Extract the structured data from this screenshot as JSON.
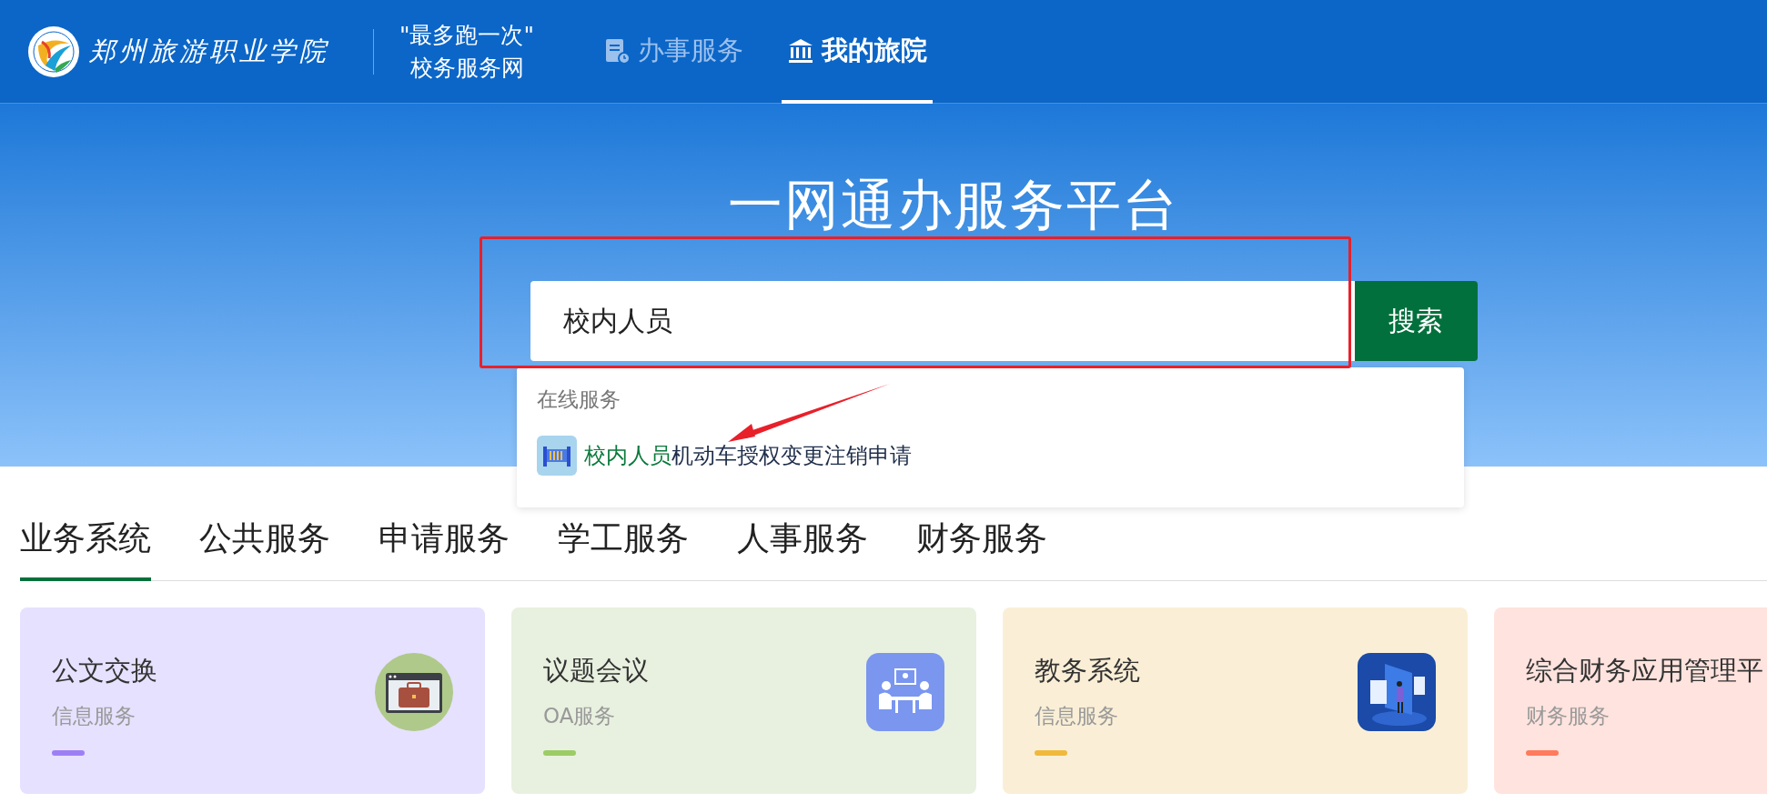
{
  "header": {
    "school_name": "郑州旅游职业学院",
    "tagline": [
      "\"最多跑一次\"",
      "校务服务网"
    ],
    "nav": [
      {
        "label": "办事服务",
        "selected": false
      },
      {
        "label": "我的旅院",
        "selected": true
      }
    ]
  },
  "hero": {
    "title": "一网通办服务平台",
    "search": {
      "value": "校内人员",
      "button": "搜索"
    },
    "suggestions": {
      "heading": "在线服务",
      "items": [
        {
          "match": "校内人员",
          "rest": "机动车授权变更注销申请"
        }
      ]
    }
  },
  "annotation_box": true,
  "annotation_arrow": true,
  "tabs": [
    {
      "label": "业务系统",
      "selected": true
    },
    {
      "label": "公共服务",
      "selected": false
    },
    {
      "label": "申请服务",
      "selected": false
    },
    {
      "label": "学工服务",
      "selected": false
    },
    {
      "label": "人事服务",
      "selected": false
    },
    {
      "label": "财务服务",
      "selected": false
    }
  ],
  "cards": [
    {
      "title": "公文交换",
      "subtitle": "信息服务",
      "color": "#9d7ff5"
    },
    {
      "title": "议题会议",
      "subtitle": "OA服务",
      "color": "#9ccc65"
    },
    {
      "title": "教务系统",
      "subtitle": "信息服务",
      "color": "#f0b93c"
    },
    {
      "title": "综合财务应用管理平",
      "subtitle": "财务服务",
      "color": "#ff7b5c"
    }
  ]
}
